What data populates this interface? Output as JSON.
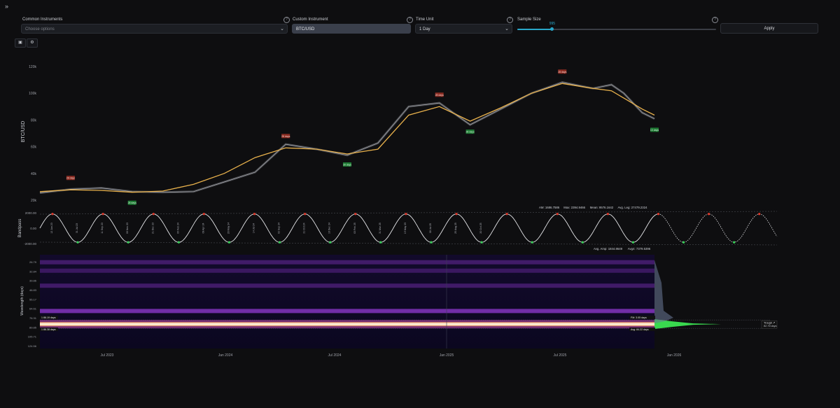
{
  "sidebar_toggle": {
    "glyph": "»",
    "icon": "chevrons-right-icon"
  },
  "controls": {
    "common_instruments": {
      "label": "Common Instruments",
      "placeholder": "Choose options"
    },
    "custom_instrument": {
      "label": "Custom Instrument",
      "value": "BTC/USD"
    },
    "time_unit": {
      "label": "Time Unit",
      "value": "1 Day"
    },
    "sample_size": {
      "label": "Sample Size",
      "value": "995",
      "fraction": 0.175
    },
    "apply_label": "Apply",
    "help_glyph": "?"
  },
  "chart_tools": [
    {
      "icon": "image-icon",
      "glyph": "▣"
    },
    {
      "icon": "gear-icon",
      "glyph": "⚙"
    }
  ],
  "colors": {
    "price": "#7d7f86",
    "trend": "#e8b14c",
    "peak": "#c0392b",
    "trough": "#27a844",
    "spectrum": "#9b3de0",
    "hot": "#fff2d6"
  },
  "chart_data": [
    {
      "type": "line",
      "ylabel": "BTC/USD",
      "y_ticks": [
        "120k",
        "100k",
        "80k",
        "60k",
        "40k",
        "20k"
      ],
      "ylim": [
        20000,
        130000
      ],
      "x_ticks": [
        "Jul 2023",
        "Jan 2024",
        "Jul 2024",
        "Jan 2025",
        "Jul 2025",
        "Jan 2026"
      ],
      "series": [
        {
          "name": "price",
          "x": [
            0,
            0.05,
            0.1,
            0.15,
            0.2,
            0.25,
            0.3,
            0.35,
            0.4,
            0.45,
            0.5,
            0.55,
            0.6,
            0.65,
            0.7,
            0.75,
            0.8,
            0.85,
            0.9,
            0.93,
            0.95,
            0.98,
            1.0
          ],
          "values": [
            26000,
            29000,
            30000,
            27000,
            26500,
            27000,
            35000,
            43000,
            66000,
            62000,
            57000,
            67000,
            97000,
            100000,
            82000,
            95000,
            108000,
            117000,
            112000,
            115000,
            108000,
            92000,
            87000
          ]
        },
        {
          "name": "trend",
          "x": [
            0,
            0.05,
            0.1,
            0.15,
            0.2,
            0.25,
            0.3,
            0.35,
            0.4,
            0.45,
            0.5,
            0.55,
            0.6,
            0.65,
            0.7,
            0.75,
            0.8,
            0.85,
            0.9,
            0.93,
            0.95,
            0.98,
            1.0
          ],
          "values": [
            27000,
            28500,
            28000,
            26500,
            27500,
            33000,
            42000,
            55000,
            63000,
            62000,
            58000,
            62000,
            90000,
            97000,
            85000,
            96000,
            108000,
            116000,
            112000,
            110000,
            104000,
            95000,
            90000
          ]
        }
      ],
      "annotations": {
        "peak": "28 days",
        "trough": "28 days",
        "last": "13 days"
      }
    },
    {
      "type": "line",
      "ylabel": "Bandpass",
      "y_ticks": [
        "2000.00",
        "0.00",
        "-2000.00"
      ],
      "ylim": [
        -2200,
        2200
      ],
      "legend_top": [
        "AM: 1686.7586",
        "Max: 2394.9466",
        "Mean: 9576.1642",
        "Avg. Leg: 27479.2324"
      ],
      "legend_bottom": [
        "Avg. Amp: 1844.8649",
        "Avg4: 7379.5396"
      ],
      "cycle_count": 14.6,
      "projection_start": 0.84,
      "date_labels": [
        "12 Jun 23",
        "31 Jul 23",
        "11 Sep 23",
        "06 Nov 23",
        "21 Dec 23",
        "09 Feb 24",
        "08 Apr 24",
        "20 May 24",
        "14 Jul 24",
        "02 Sep 24",
        "21 Oct 24",
        "16 Dec 24",
        "03 Feb 25",
        "31 Mar 25",
        "19 May 25",
        "08 Jul 25",
        "25 Aug 25",
        "20 Oct 25"
      ]
    },
    {
      "type": "heatmap",
      "ylabel": "Wavelength (days)",
      "y_ticks": [
        "26.79",
        "32.84",
        "39.86",
        "46.83",
        "55.17",
        "64.61",
        "76.31",
        "89.85",
        "105.71",
        "124.56"
      ],
      "bands": [
        {
          "y": 0.08,
          "intensity": 0.35
        },
        {
          "y": 0.17,
          "intensity": 0.3
        },
        {
          "y": 0.33,
          "intensity": 0.35
        },
        {
          "y": 0.6,
          "intensity": 0.7
        },
        {
          "y": 0.74,
          "intensity": 1.0
        }
      ],
      "markers": [
        "1 86.19 days",
        "1 86.38 days"
      ],
      "right_labels": [
        "FM: 3.05 days",
        "Avg: 84.22 days"
      ],
      "trough_box": [
        "Trough ↗",
        "82.79 days"
      ]
    }
  ]
}
